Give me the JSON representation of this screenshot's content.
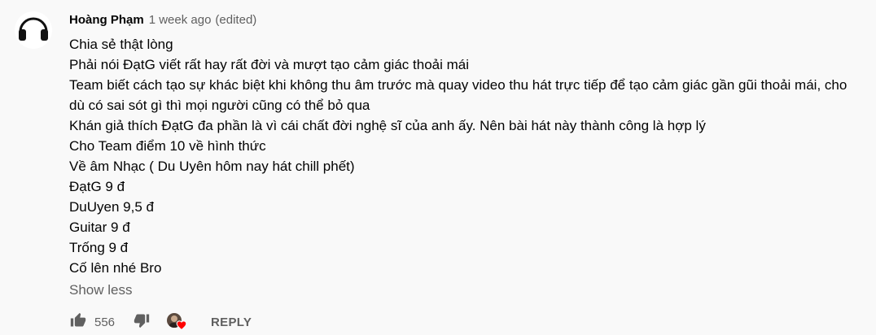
{
  "comment": {
    "author": "Hoàng Phạm",
    "time": "1 week ago",
    "edited": "(edited)",
    "lines": [
      "Chia sẻ thật lòng",
      "Phải nói ĐạtG viết rất hay rất đời và mượt tạo cảm giác thoải mái",
      "Team biết cách tạo sự khác biệt khi không thu âm trước mà quay video thu hát trực tiếp để tạo cảm giác gần gũi thoải mái, cho",
      "dù có sai sót gì thì mọi người cũng có thể bỏ qua",
      "Khán giả thích ĐạtG đa phần là vì cái chất đời nghệ sĩ của anh ấy. Nên bài hát này thành công là hợp lý",
      "Cho Team điểm 10 về hình thức",
      "Về âm Nhạc ( Du Uyên hôm nay hát chill phết)",
      "ĐạtG 9 đ",
      "DuUyen 9,5 đ",
      "Guitar 9 đ",
      "Trống 9 đ",
      "Cố lên nhé Bro"
    ],
    "show_less": "Show less",
    "like_count": "556",
    "reply_label": "REPLY"
  },
  "icons": {
    "avatar": "headphones-icon",
    "like": "thumbs-up-icon",
    "dislike": "thumbs-down-icon",
    "creator_heart": "heart-icon"
  },
  "colors": {
    "background": "#f9f9f9",
    "text": "#030303",
    "secondary": "#606060",
    "heart": "#ff0000"
  }
}
